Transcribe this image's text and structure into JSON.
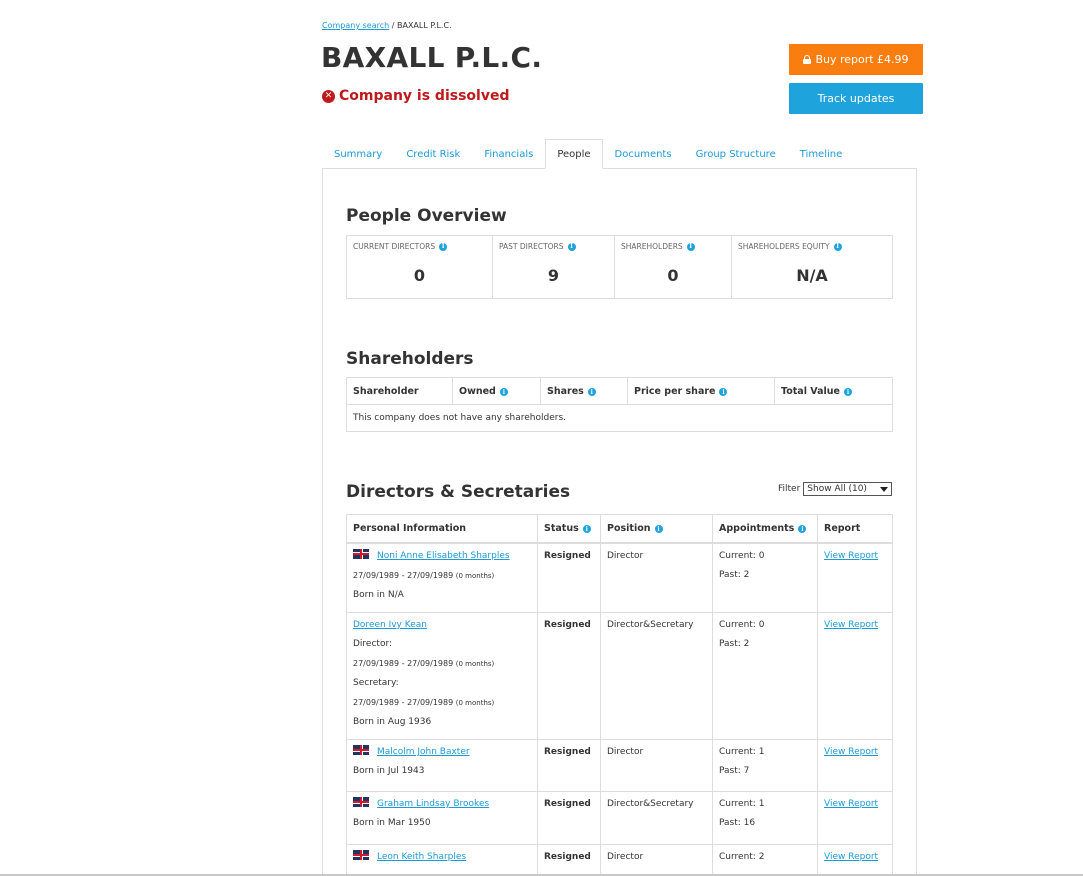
{
  "breadcrumb": {
    "link": "Company search",
    "sep": "/",
    "current": "BAXALL P.L.C."
  },
  "company": {
    "name": "BAXALL P.L.C.",
    "status": "Company is dissolved"
  },
  "actions": {
    "buy": "Buy report £4.99",
    "track": "Track updates"
  },
  "tabs": [
    "Summary",
    "Credit Risk",
    "Financials",
    "People",
    "Documents",
    "Group Structure",
    "Timeline"
  ],
  "active_tab": "People",
  "overview": {
    "title": "People Overview",
    "cells": [
      {
        "label": "CURRENT DIRECTORS",
        "value": "0"
      },
      {
        "label": "PAST DIRECTORS",
        "value": "9"
      },
      {
        "label": "SHAREHOLDERS",
        "value": "0"
      },
      {
        "label": "SHAREHOLDERS EQUITY",
        "value": "N/A"
      }
    ]
  },
  "shareholders": {
    "title": "Shareholders",
    "headers": [
      "Shareholder",
      "Owned",
      "Shares",
      "Price per share",
      "Total Value"
    ],
    "empty_message": "This company does not have any shareholders."
  },
  "directors": {
    "title": "Directors & Secretaries",
    "filter_label": "Filter",
    "filter_value": "Show All (10)",
    "headers": [
      "Personal Information",
      "Status",
      "Position",
      "Appointments",
      "Report"
    ],
    "rows": [
      {
        "name": "Noni Anne Elisabeth Sharples",
        "flag": true,
        "details": [
          "27/09/1989 - 27/09/1989",
          "Born in N/A"
        ],
        "months": "(0 months)",
        "status": "Resigned",
        "position": "Director",
        "current": "Current: 0",
        "past": "Past: 2",
        "report": "View Report"
      },
      {
        "name": "Doreen Ivy Kean",
        "flag": false,
        "director_label": "Director:",
        "director_dates": "27/09/1989 - 27/09/1989",
        "secretary_label": "Secretary:",
        "secretary_dates": "27/09/1989 - 27/09/1989",
        "months": "(0 months)",
        "born": "Born in Aug 1936",
        "status": "Resigned",
        "position": "Director&Secretary",
        "current": "Current: 0",
        "past": "Past: 2",
        "report": "View Report"
      },
      {
        "name": "Malcolm John Baxter",
        "flag": true,
        "born": "Born in Jul 1943",
        "status": "Resigned",
        "position": "Director",
        "current": "Current: 1",
        "past": "Past: 7",
        "report": "View Report"
      },
      {
        "name": "Graham Lindsay Brookes",
        "flag": true,
        "born": "Born in Mar 1950",
        "status": "Resigned",
        "position": "Director&Secretary",
        "current": "Current: 1",
        "past": "Past: 16",
        "report": "View Report"
      },
      {
        "name": "Leon Keith Sharples",
        "flag": true,
        "status": "Resigned",
        "position": "Director",
        "current": "Current: 2",
        "report": "View Report"
      }
    ]
  }
}
